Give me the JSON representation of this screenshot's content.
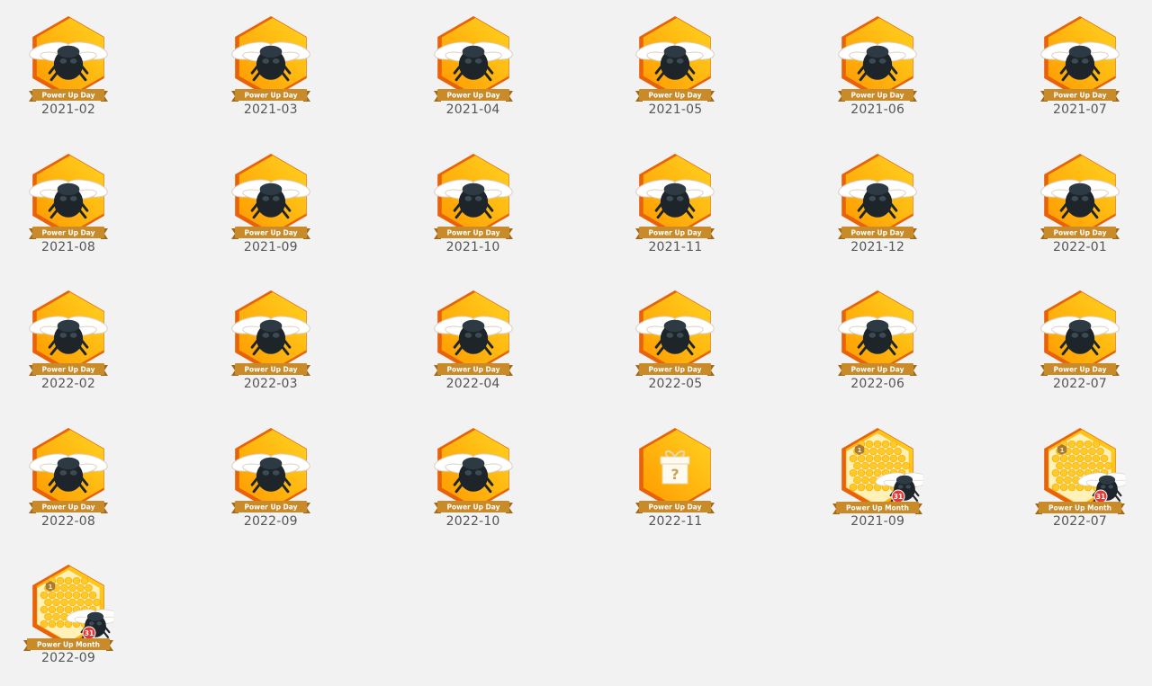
{
  "colors": {
    "background": "#f2f2f2",
    "hex_light": "#ffd21f",
    "hex_dark": "#ff9a00",
    "hex_shadow": "#e8620a",
    "ribbon": "#c98a2a",
    "ribbon_dark": "#a06a1a",
    "bee_body": "#1d252b",
    "wing": "#ffffff",
    "date_text": "#555555",
    "day_badge_red": "#e53935"
  },
  "badges": [
    {
      "type": "day",
      "label": "Power Up Day",
      "date": "2021-02"
    },
    {
      "type": "day",
      "label": "Power Up Day",
      "date": "2021-03"
    },
    {
      "type": "day",
      "label": "Power Up Day",
      "date": "2021-04"
    },
    {
      "type": "day",
      "label": "Power Up Day",
      "date": "2021-05"
    },
    {
      "type": "day",
      "label": "Power Up Day",
      "date": "2021-06"
    },
    {
      "type": "day",
      "label": "Power Up Day",
      "date": "2021-07"
    },
    {
      "type": "day",
      "label": "Power Up Day",
      "date": "2021-08"
    },
    {
      "type": "day",
      "label": "Power Up Day",
      "date": "2021-09"
    },
    {
      "type": "day",
      "label": "Power Up Day",
      "date": "2021-10"
    },
    {
      "type": "day",
      "label": "Power Up Day",
      "date": "2021-11"
    },
    {
      "type": "day",
      "label": "Power Up Day",
      "date": "2021-12"
    },
    {
      "type": "day",
      "label": "Power Up Day",
      "date": "2022-01"
    },
    {
      "type": "day",
      "label": "Power Up Day",
      "date": "2022-02"
    },
    {
      "type": "day",
      "label": "Power Up Day",
      "date": "2022-03"
    },
    {
      "type": "day",
      "label": "Power Up Day",
      "date": "2022-04"
    },
    {
      "type": "day",
      "label": "Power Up Day",
      "date": "2022-05"
    },
    {
      "type": "day",
      "label": "Power Up Day",
      "date": "2022-06"
    },
    {
      "type": "day",
      "label": "Power Up Day",
      "date": "2022-07"
    },
    {
      "type": "day",
      "label": "Power Up Day",
      "date": "2022-08"
    },
    {
      "type": "day",
      "label": "Power Up Day",
      "date": "2022-09"
    },
    {
      "type": "day",
      "label": "Power Up Day",
      "date": "2022-10"
    },
    {
      "type": "mystery",
      "label": "Power Up Day",
      "date": "2022-11",
      "icon": "gift-box-question-icon",
      "glyph": "?"
    },
    {
      "type": "month",
      "label": "Power Up Month",
      "date": "2021-09",
      "start_num": "1",
      "end_num": "31"
    },
    {
      "type": "month",
      "label": "Power Up Month",
      "date": "2022-07",
      "start_num": "1",
      "end_num": "31"
    },
    {
      "type": "month",
      "label": "Power Up Month",
      "date": "2022-09",
      "start_num": "1",
      "end_num": "31"
    }
  ]
}
